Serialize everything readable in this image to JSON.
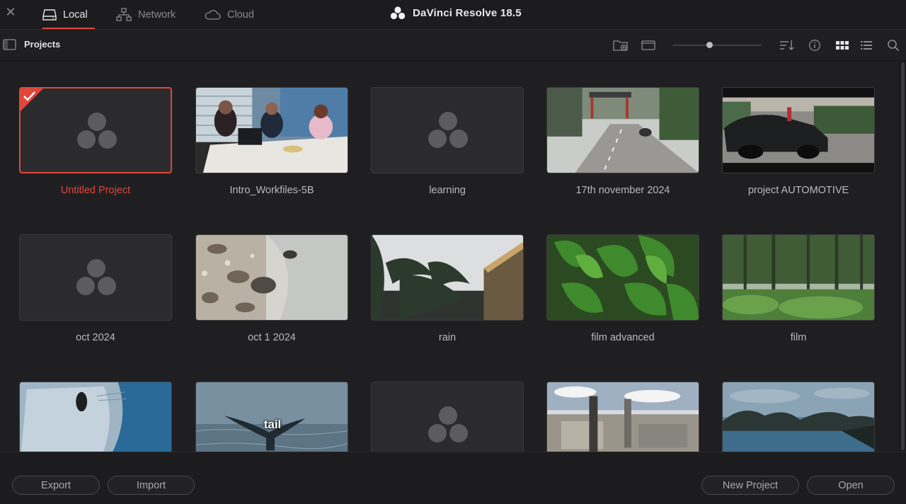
{
  "window": {
    "close_glyph": "✕",
    "brand": "DaVinci Resolve 18.5"
  },
  "tabs": [
    {
      "label": "Local",
      "icon": "hard-drive-icon",
      "active": true
    },
    {
      "label": "Network",
      "icon": "network-icon",
      "active": false
    },
    {
      "label": "Cloud",
      "icon": "cloud-icon",
      "active": false
    }
  ],
  "toolbar": {
    "title": "Projects",
    "zoom_level": 0.42,
    "icons": [
      "new-folder-icon",
      "single-view-icon",
      "sort-icon",
      "info-icon",
      "grid-view-icon",
      "list-view-icon",
      "search-icon"
    ]
  },
  "projects": [
    {
      "name": "Untitled Project",
      "thumb": "placeholder",
      "selected": true
    },
    {
      "name": "Intro_Workfiles-5B",
      "thumb": "meeting-room"
    },
    {
      "name": "learning",
      "thumb": "placeholder"
    },
    {
      "name": "17th november 2024",
      "thumb": "street"
    },
    {
      "name": "project AUTOMOTIVE",
      "thumb": "car"
    },
    {
      "name": "oct 2024",
      "thumb": "placeholder"
    },
    {
      "name": "oct 1 2024",
      "thumb": "river-rocks"
    },
    {
      "name": "rain",
      "thumb": "palm-trees"
    },
    {
      "name": "film advanced",
      "thumb": "leaves"
    },
    {
      "name": "film",
      "thumb": "forest"
    },
    {
      "name": "",
      "thumb": "seal"
    },
    {
      "name": "",
      "thumb": "whale-tail",
      "overlay": "tail"
    },
    {
      "name": "",
      "thumb": "placeholder"
    },
    {
      "name": "",
      "thumb": "ruins"
    },
    {
      "name": "",
      "thumb": "bay"
    }
  ],
  "footer": {
    "export": "Export",
    "import": "Import",
    "new_project": "New Project",
    "open": "Open"
  },
  "colors": {
    "accent": "#e0463a",
    "background": "#1f1f22",
    "placeholder": "#2b2b2e"
  }
}
